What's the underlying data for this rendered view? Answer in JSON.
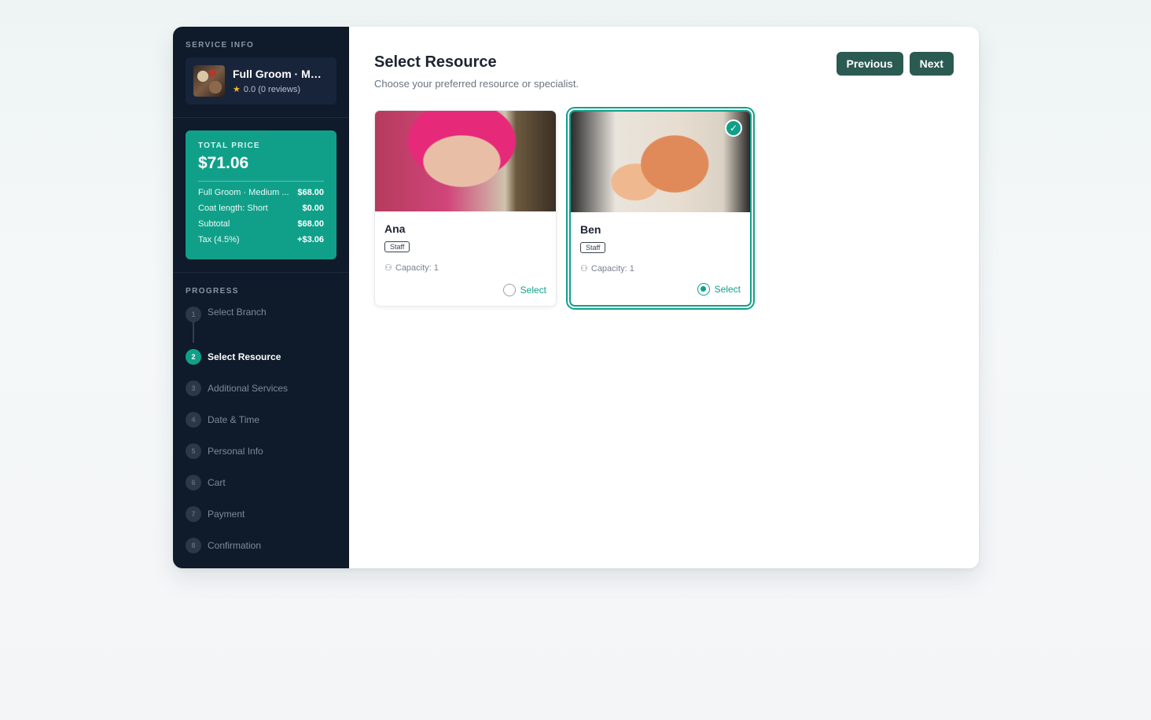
{
  "sidebar": {
    "service_info_label": "SERVICE INFO",
    "service": {
      "title": "Full Groom · Me...",
      "rating": "0.0 (0 reviews)"
    },
    "price": {
      "label": "TOTAL PRICE",
      "total": "$71.06",
      "rows": [
        {
          "label": "Full Groom · Medium ...",
          "value": "$68.00"
        },
        {
          "label": "Coat length: Short",
          "value": "$0.00"
        },
        {
          "label": "Subtotal",
          "value": "$68.00"
        },
        {
          "label": "Tax (4.5%)",
          "value": "+$3.06"
        }
      ]
    },
    "progress_label": "PROGRESS",
    "steps": [
      {
        "num": "1",
        "name": "Select Branch"
      },
      {
        "num": "2",
        "name": "Select Resource"
      },
      {
        "num": "3",
        "name": "Additional Services"
      },
      {
        "num": "4",
        "name": "Date & Time"
      },
      {
        "num": "5",
        "name": "Personal Info"
      },
      {
        "num": "6",
        "name": "Cart"
      },
      {
        "num": "7",
        "name": "Payment"
      },
      {
        "num": "8",
        "name": "Confirmation"
      }
    ],
    "active_step": 2
  },
  "main": {
    "title": "Select Resource",
    "subtitle": "Choose your preferred resource or specialist.",
    "prev_label": "Previous",
    "next_label": "Next",
    "resources": [
      {
        "name": "Ana",
        "badge": "Staff",
        "capacity": "Capacity: 1",
        "select_label": "Select",
        "selected": false
      },
      {
        "name": "Ben",
        "badge": "Staff",
        "capacity": "Capacity: 1",
        "select_label": "Select",
        "selected": true
      }
    ]
  },
  "colors": {
    "accent": "#10a08a",
    "sidebar_bg": "#0f1a2a",
    "button_bg": "#2a5a52"
  },
  "icons": {
    "rating": "star-icon",
    "capacity": "capacity-icon",
    "selected": "check-icon"
  }
}
